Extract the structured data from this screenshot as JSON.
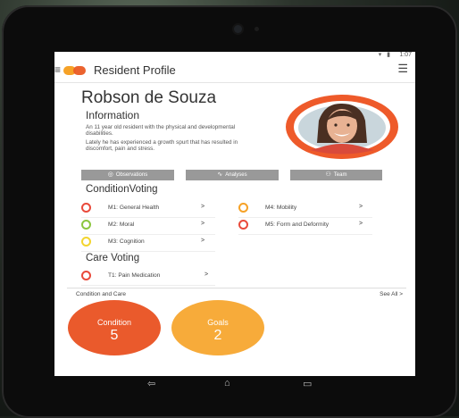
{
  "status": {
    "time": "1:07",
    "icons": "▾ ▮"
  },
  "appbar": {
    "title": "Resident Profile"
  },
  "profile": {
    "name": "Robson de Souza",
    "info_heading": "Information",
    "info_line1": "An 11 year old resident with the physical and developmental disabilities.",
    "info_line2": "Lately he has experienced a growth spurt that has resulted in discomfort, pain and stress."
  },
  "tabs": [
    {
      "label": "Observations",
      "icon": "eye-icon"
    },
    {
      "label": "Analyses",
      "icon": "trend-icon"
    },
    {
      "label": "Team",
      "icon": "team-icon"
    }
  ],
  "condition_voting": {
    "heading": "ConditionVoting",
    "items": [
      {
        "label": "M1: General Health",
        "color": "#e94a3b"
      },
      {
        "label": "M2: Moral",
        "color": "#8cc63f"
      },
      {
        "label": "M3: Cognition",
        "color": "#f3d52f"
      },
      {
        "label": "M4: Mobility",
        "color": "#f6a227"
      },
      {
        "label": "M5: Form and Deformity",
        "color": "#e94a3b"
      }
    ]
  },
  "care_voting": {
    "heading": "Care Voting",
    "items": [
      {
        "label": "T1: Pain Medication",
        "color": "#e94a3b"
      }
    ]
  },
  "footer": {
    "left": "Condition and Care",
    "right": "See All"
  },
  "circles": [
    {
      "title": "Condition",
      "value": "5",
      "color": "#ea5a2c"
    },
    {
      "title": "Goals",
      "value": "2",
      "color": "#f7ab3a"
    }
  ],
  "chevron": ">"
}
